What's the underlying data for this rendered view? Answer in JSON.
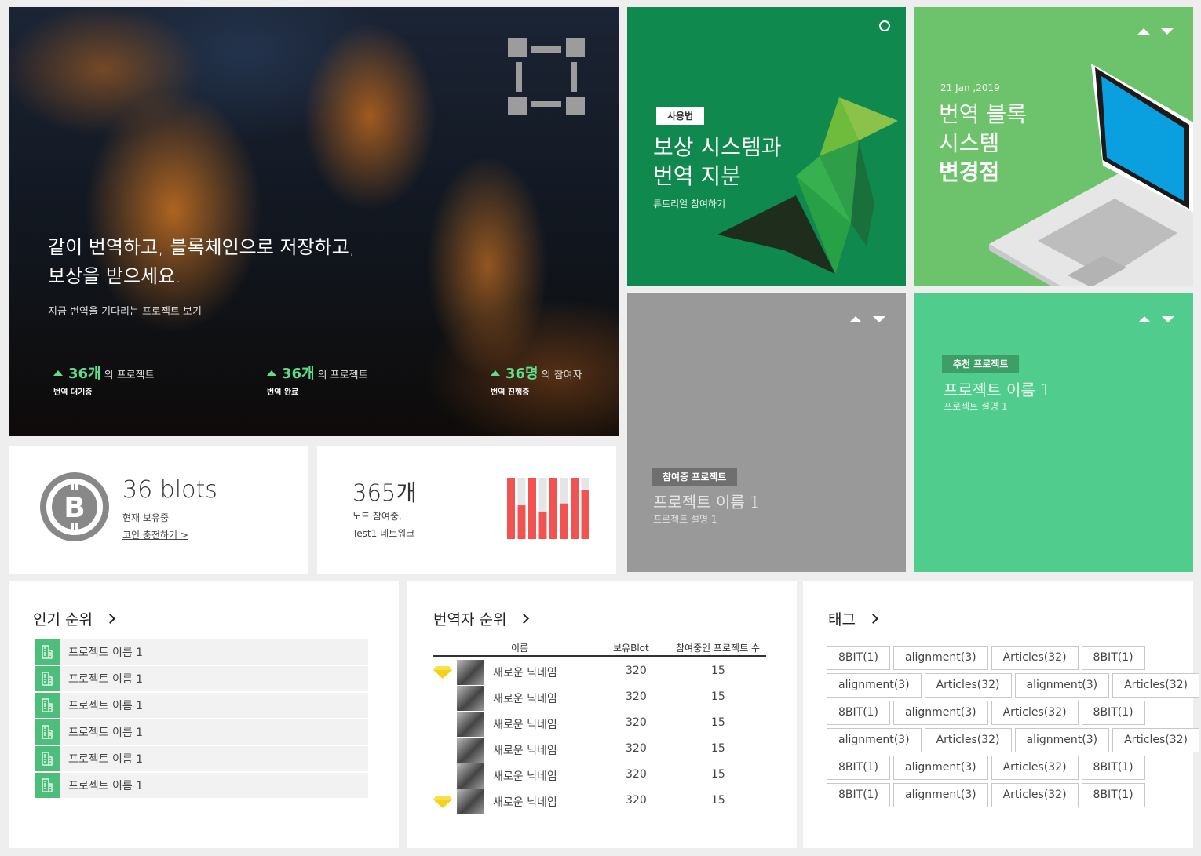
{
  "hero": {
    "headline_line1": "같이 번역하고, 블록체인으로 저장하고,",
    "headline_line2": "보상을 받으세요.",
    "sub": "지금 번역을 기다리는 프로젝트 보기",
    "stats": [
      {
        "value": "36개",
        "unit": "의 프로젝트",
        "label": "번역 대기중"
      },
      {
        "value": "36개",
        "unit": "의 프로젝트",
        "label": "번역 완료"
      },
      {
        "value": "36명",
        "unit": "의 참여자",
        "label": "번역 진행중"
      }
    ]
  },
  "tiles": {
    "tutorial": {
      "badge": "사용법",
      "title_line1": "보상 시스템과",
      "title_line2": "번역 지분",
      "sub": "튜토리얼 참여하기"
    },
    "change": {
      "date": "21 Jan ,2019",
      "title_line1": "번역 블록",
      "title_line2": "시스템",
      "title_line3": "변경점"
    },
    "participating": {
      "badge": "참여중 프로젝트",
      "title": "프로젝트 이름 1",
      "sub": "프로젝트 설명 1"
    },
    "recommend": {
      "badge": "추천 프로젝트",
      "title": "프로젝트 이름 1",
      "sub": "프로젝트 설명 1"
    }
  },
  "coin": {
    "amount": "36 blots",
    "label": "현재 보유중",
    "link": "코인 충전하기 >"
  },
  "node": {
    "count": "365개",
    "line1": "노드 참여중,",
    "line2": "Test1 네트워크"
  },
  "bar_chart": {
    "type": "bar",
    "values": [
      1.0,
      0.55,
      1.0,
      0.45,
      1.0,
      0.58,
      1.0,
      0.8
    ],
    "colors": {
      "value": "#f05350",
      "track": "#e5e5e5"
    }
  },
  "popular": {
    "title": "인기 순위",
    "items": [
      "프로젝트 이름 1",
      "프로젝트 이름 1",
      "프로젝트 이름 1",
      "프로젝트 이름 1",
      "프로젝트 이름 1",
      "프로젝트 이름 1"
    ]
  },
  "translators": {
    "title": "번역자 순위",
    "headers": {
      "name": "이름",
      "blot": "보유Blot",
      "projects": "참여중인 프로젝트 수"
    },
    "rows": [
      {
        "name": "새로운 닉네임",
        "blot": "320",
        "projects": "15",
        "gem": true
      },
      {
        "name": "새로운 닉네임",
        "blot": "320",
        "projects": "15",
        "gem": false
      },
      {
        "name": "새로운 닉네임",
        "blot": "320",
        "projects": "15",
        "gem": false
      },
      {
        "name": "새로운 닉네임",
        "blot": "320",
        "projects": "15",
        "gem": false
      },
      {
        "name": "새로운 닉네임",
        "blot": "320",
        "projects": "15",
        "gem": false
      },
      {
        "name": "새로운 닉네임",
        "blot": "320",
        "projects": "15",
        "gem": true
      }
    ]
  },
  "tags": {
    "title": "태그",
    "rows": [
      [
        "8BIT(1)",
        "alignment(3)",
        "Articles(32)",
        "8BIT(1)"
      ],
      [
        "alignment(3)",
        "Articles(32)",
        "alignment(3)",
        "Articles(32)"
      ],
      [
        "8BIT(1)",
        "alignment(3)",
        "Articles(32)",
        "8BIT(1)"
      ],
      [
        "alignment(3)",
        "Articles(32)",
        "alignment(3)",
        "Articles(32)"
      ],
      [
        "8BIT(1)",
        "alignment(3)",
        "Articles(32)",
        "8BIT(1)"
      ],
      [
        "8BIT(1)",
        "alignment(3)",
        "Articles(32)",
        "8BIT(1)"
      ]
    ]
  },
  "colors": {
    "accent_green": "#5fdc8e",
    "tutorial_bg": "#10894f",
    "change_bg": "#6cc36b",
    "participating_bg": "#999999",
    "recommend_bg": "#50cd8d",
    "chart_red": "#f05350"
  }
}
